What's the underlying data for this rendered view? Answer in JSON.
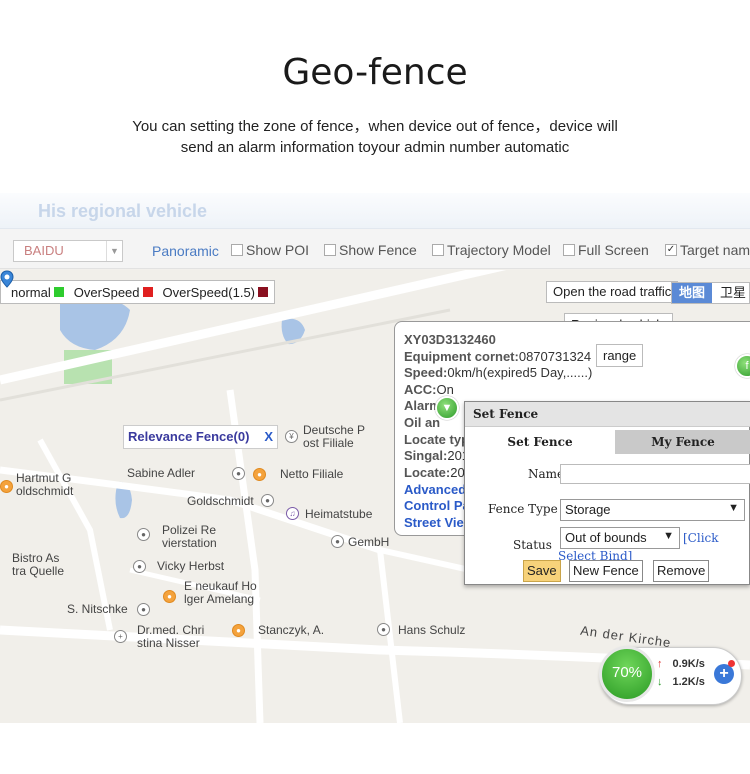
{
  "headline": "Geo-fence",
  "description": {
    "line1": "You can setting the zone of fence，when device out of fence，device will",
    "line2": "send an alarm information toyour admin number automatic"
  },
  "app": {
    "title": "His regional vehicle"
  },
  "toolbar": {
    "map_provider": "BAIDU",
    "panoramic": "Panoramic",
    "checks": [
      {
        "label": "Show POI",
        "checked": false
      },
      {
        "label": "Show Fence",
        "checked": false
      },
      {
        "label": "Trajectory Model",
        "checked": false
      },
      {
        "label": "Full Screen",
        "checked": false
      },
      {
        "label": "Target nam",
        "checked": true
      }
    ]
  },
  "legend": [
    {
      "label": "normal",
      "color": "#2ecc2e"
    },
    {
      "label": "OverSpeed",
      "color": "#e02020"
    },
    {
      "label": "OverSpeed(1.5)",
      "color": "#8a1020"
    }
  ],
  "map_controls": {
    "road_traffic": "Open the road traffic",
    "map_type_map": "地图",
    "map_type_satellite": "卫星",
    "regional_vehicle": "Regional vehicle",
    "range": "range"
  },
  "relevance": {
    "label": "Relevance Fence(0)",
    "close": "X"
  },
  "map_labels": [
    {
      "text": "Deutsche P\nost Filiale"
    },
    {
      "text": "Hartmut G\noldschmidt"
    },
    {
      "text": "Sabine Adler"
    },
    {
      "text": "Netto Filiale"
    },
    {
      "text": "Goldschmidt"
    },
    {
      "text": "Heimatstube"
    },
    {
      "text": "Polizei Re\nvierstation"
    },
    {
      "text": "GembH"
    },
    {
      "text": "Bistro As\ntra Quelle"
    },
    {
      "text": "Vicky Herbst"
    },
    {
      "text": "E neukauf Ho\nlger Amelang"
    },
    {
      "text": "S. Nitschke"
    },
    {
      "text": "Dr.med. Chri\nstina Nisser"
    },
    {
      "text": "Stanczyk, A."
    },
    {
      "text": "Hans Schulz"
    },
    {
      "text": "An der Kirche"
    }
  ],
  "info": {
    "device_id": "XY03D3132460",
    "equipment_label": "Equipment cornet:",
    "equipment_value": "0870731324",
    "speed_label": "Speed:",
    "speed_value": "0km/h(expired5 Day,......)",
    "acc_label": "ACC:",
    "acc_value": "On",
    "alarm_label": "Alarm",
    "oil_label": "Oil an",
    "locate_type_label": "Locate typ",
    "signal_label": "Singal:",
    "signal_value": "201",
    "locate_label": "Locate:",
    "locate_value": "20",
    "link_advanced": "Advanced",
    "link_control": "Control Pa",
    "link_street": "Street Vie"
  },
  "fence": {
    "header": "Set Fence",
    "tab_set": "Set Fence",
    "tab_my": "My Fence",
    "name_label": "Name",
    "name_value": "",
    "type_label": "Fence Type",
    "type_value": "Storage",
    "status_label": "Status",
    "status_value": "Out of bounds",
    "click_text": "[Click",
    "bind_text": "Select Bind]",
    "save": "Save",
    "new_fence": "New Fence",
    "remove": "Remove"
  },
  "speed_widget": {
    "percent": "70%",
    "upload": "0.9K/s",
    "download": "1.2K/s",
    "plus": "+"
  }
}
